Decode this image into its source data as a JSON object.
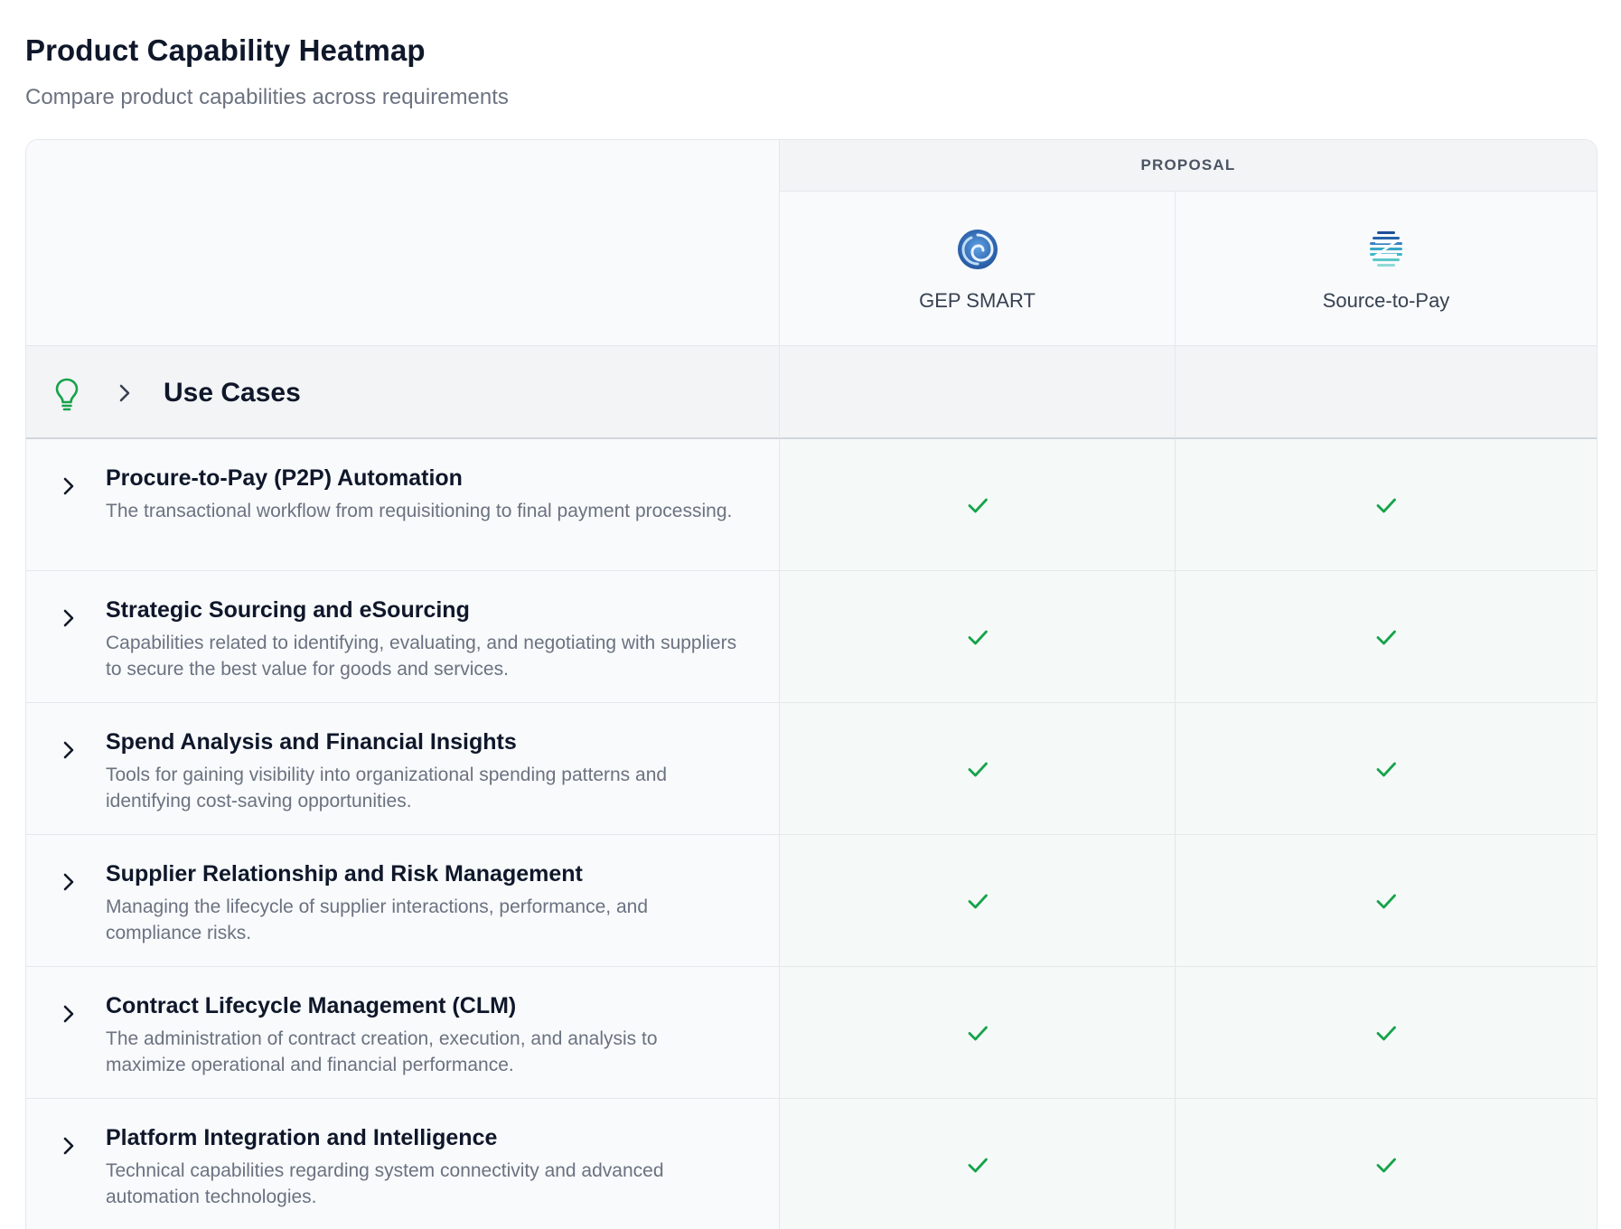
{
  "header": {
    "title": "Product Capability Heatmap",
    "subtitle": "Compare product capabilities across requirements"
  },
  "heatmap": {
    "group_label": "PROPOSAL",
    "products": [
      {
        "name": "GEP SMART",
        "logo_icon": "gep-smart-logo-icon",
        "logo_color": "#2563a8"
      },
      {
        "name": "Source-to-Pay",
        "logo_icon": "source-to-pay-logo-icon",
        "logo_color": "#3aa7c8"
      }
    ],
    "section": {
      "title": "Use Cases",
      "icon": "lightbulb-icon",
      "icon_color": "#16a34a"
    },
    "rows": [
      {
        "title": "Procure-to-Pay (P2P) Automation",
        "description": "The transactional workflow from requisitioning to final payment processing.",
        "values": [
          "check",
          "check"
        ]
      },
      {
        "title": "Strategic Sourcing and eSourcing",
        "description": "Capabilities related to identifying, evaluating, and negotiating with suppliers to secure the best value for goods and services.",
        "values": [
          "check",
          "check"
        ]
      },
      {
        "title": "Spend Analysis and Financial Insights",
        "description": "Tools for gaining visibility into organizational spending patterns and identifying cost-saving opportunities.",
        "values": [
          "check",
          "check"
        ]
      },
      {
        "title": "Supplier Relationship and Risk Management",
        "description": "Managing the lifecycle of supplier interactions, performance, and compliance risks.",
        "values": [
          "check",
          "check"
        ]
      },
      {
        "title": "Contract Lifecycle Management (CLM)",
        "description": "The administration of contract creation, execution, and analysis to maximize operational and financial performance.",
        "values": [
          "check",
          "check"
        ]
      },
      {
        "title": "Platform Integration and Intelligence",
        "description": "Technical capabilities regarding system connectivity and advanced automation technologies.",
        "values": [
          "check",
          "check"
        ]
      }
    ],
    "colors": {
      "check": "#16a34a",
      "supported_cell_bg": "#f5faf8"
    }
  }
}
